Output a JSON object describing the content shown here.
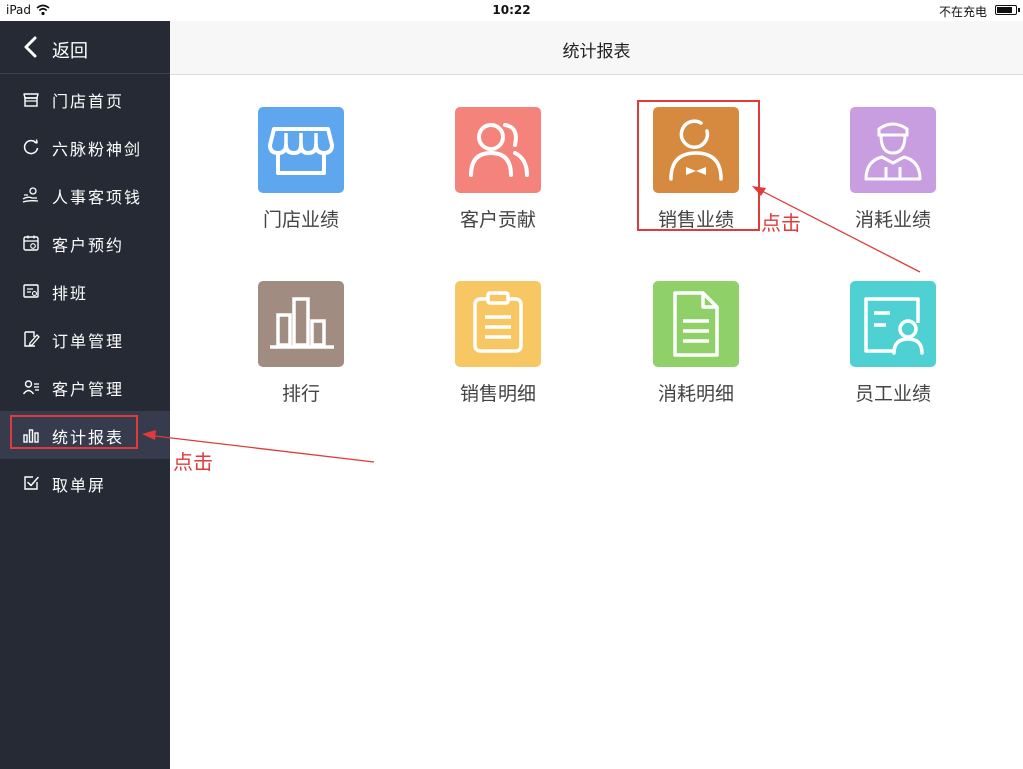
{
  "status_bar": {
    "device": "iPad",
    "time": "10:22",
    "battery_text": "不在充电",
    "battery_level": 0.85
  },
  "sidebar": {
    "back_label": "返回",
    "items": [
      {
        "label": "门店首页",
        "icon": "store-icon"
      },
      {
        "label": "六脉粉神剑",
        "icon": "refresh-icon"
      },
      {
        "label": "人事客项钱",
        "icon": "money-hand-icon"
      },
      {
        "label": "客户预约",
        "icon": "calendar-icon"
      },
      {
        "label": "排班",
        "icon": "schedule-icon"
      },
      {
        "label": "订单管理",
        "icon": "order-edit-icon"
      },
      {
        "label": "客户管理",
        "icon": "customer-list-icon"
      },
      {
        "label": "统计报表",
        "icon": "bar-chart-icon",
        "active": true
      },
      {
        "label": "取单屏",
        "icon": "checkbox-icon"
      }
    ]
  },
  "header": {
    "title": "统计报表"
  },
  "tiles": [
    {
      "label": "门店业绩",
      "icon": "storefront-icon",
      "color": "#5ea7ee"
    },
    {
      "label": "客户贡献",
      "icon": "customers-icon",
      "color": "#f3837b"
    },
    {
      "label": "销售业绩",
      "icon": "salesperson-icon",
      "color": "#d68a3f"
    },
    {
      "label": "消耗业绩",
      "icon": "worker-icon",
      "color": "#c89ee0"
    },
    {
      "label": "排行",
      "icon": "ranking-icon",
      "color": "#a08c80"
    },
    {
      "label": "销售明细",
      "icon": "clipboard-icon",
      "color": "#f7c764"
    },
    {
      "label": "消耗明细",
      "icon": "document-icon",
      "color": "#8fd068"
    },
    {
      "label": "员工业绩",
      "icon": "employee-card-icon",
      "color": "#4fd1d4"
    }
  ],
  "annotations": {
    "click_label_1": "点击",
    "click_label_2": "点击"
  },
  "colors": {
    "sidebar_bg": "#262a34",
    "sidebar_active_bg": "#363c4e",
    "annotation_red": "#e03a3a"
  }
}
